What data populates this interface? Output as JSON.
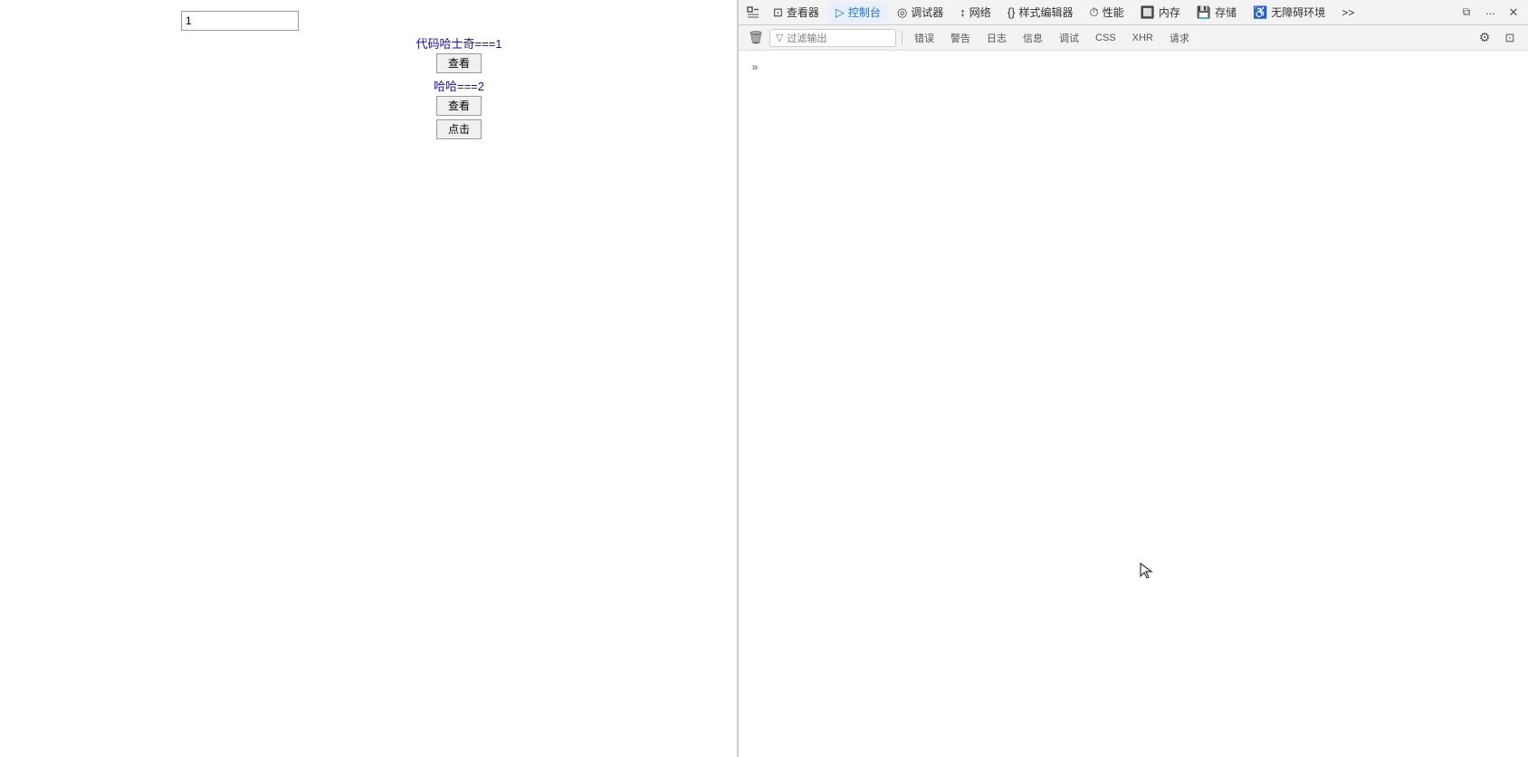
{
  "page": {
    "input_value": "1",
    "text_line1": "代码哈士奇===1",
    "btn1_label": "查看",
    "text_line2": "哈哈===2",
    "btn2_label": "查看",
    "btn3_label": "点击"
  },
  "devtools": {
    "toolbar": {
      "inspect_icon": "⊡",
      "inspect_label": "查看器",
      "console_label": "控制台",
      "debugger_label": "调试器",
      "network_label": "网络",
      "style_label": "样式编辑器",
      "perf_label": "性能",
      "memory_label": "内存",
      "storage_label": "存储",
      "accessibility_label": "无障碍环境",
      "more_label": ">>",
      "dock_icon": "⧉",
      "more_options": "···",
      "close_icon": "✕"
    },
    "console_toolbar": {
      "delete_icon": "🗑",
      "filter_placeholder": "过滤输出",
      "error_label": "错误",
      "warn_label": "警告",
      "log_label": "日志",
      "info_label": "信息",
      "debug_label": "调试",
      "css_label": "CSS",
      "xhr_label": "XHR",
      "requests_label": "请求",
      "settings_icon": "⚙"
    },
    "console_expand": "»",
    "sidebar_expand": "»"
  }
}
